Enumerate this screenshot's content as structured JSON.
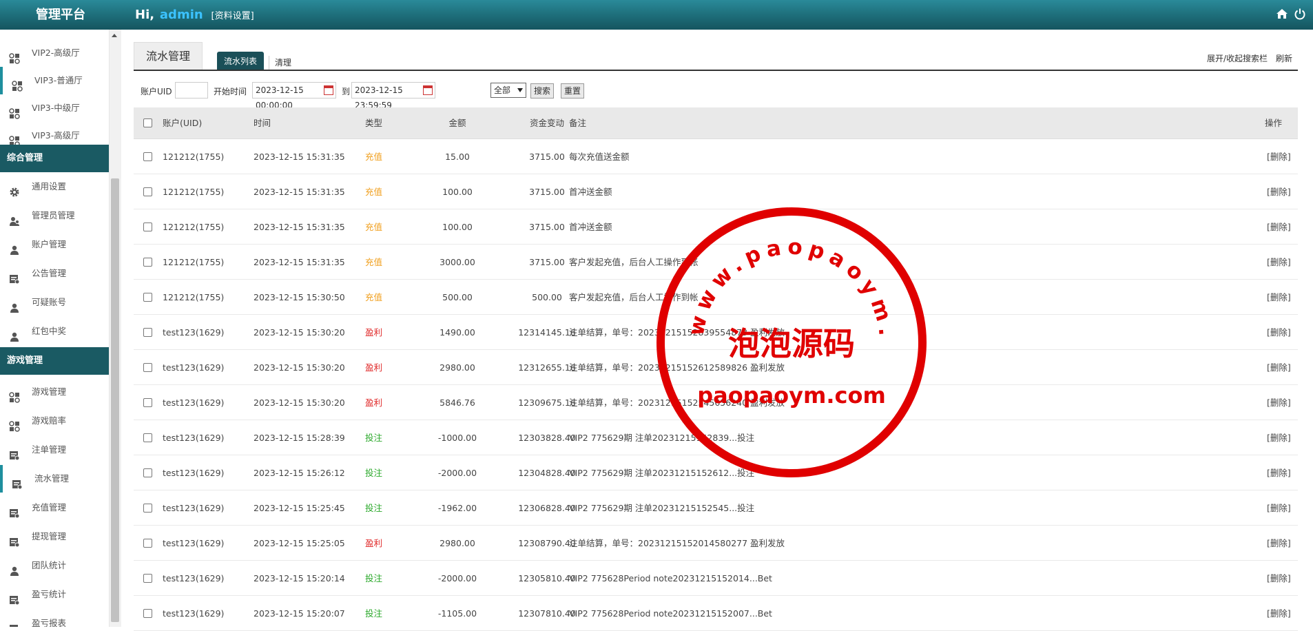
{
  "header": {
    "brand": "管理平台",
    "greeting": "Hi,",
    "user": "admin",
    "profile_link": "[资料设置]"
  },
  "sidebar": {
    "items_top": [
      {
        "label": "VIP2-高级厅",
        "icon": "grid-icon"
      },
      {
        "label": "VIP3-普通厅",
        "icon": "grid-icon"
      },
      {
        "label": "VIP3-中级厅",
        "icon": "grid-icon"
      },
      {
        "label": "VIP3-高级厅",
        "icon": "grid-icon"
      }
    ],
    "group1": "综合管理",
    "items_g1": [
      {
        "label": "通用设置",
        "icon": "gear-icon"
      },
      {
        "label": "管理员管理",
        "icon": "user-group-icon"
      },
      {
        "label": "账户管理",
        "icon": "user-icon"
      },
      {
        "label": "公告管理",
        "icon": "doc-icon"
      },
      {
        "label": "可疑账号",
        "icon": "user-icon"
      },
      {
        "label": "红包中奖",
        "icon": "user-icon"
      }
    ],
    "group2": "游戏管理",
    "items_g2": [
      {
        "label": "游戏管理",
        "icon": "grid-icon"
      },
      {
        "label": "游戏赔率",
        "icon": "grid-icon"
      },
      {
        "label": "注单管理",
        "icon": "doc-icon"
      },
      {
        "label": "流水管理",
        "icon": "doc-icon"
      },
      {
        "label": "充值管理",
        "icon": "doc-icon"
      },
      {
        "label": "提现管理",
        "icon": "doc-icon"
      },
      {
        "label": "团队统计",
        "icon": "user-icon"
      },
      {
        "label": "盈亏统计",
        "icon": "doc-icon"
      },
      {
        "label": "盈亏报表",
        "icon": "doc-icon"
      }
    ]
  },
  "tabs": {
    "main": "流水管理",
    "list": "流水列表",
    "clear": "清理",
    "toggle": "展开/收起搜索栏",
    "refresh": "刷新"
  },
  "filter": {
    "uid_label": "账户UID",
    "uid_value": "",
    "start_label": "开始时间",
    "start_value": "2023-12-15 00:00:00",
    "to_label": "到",
    "end_value": "2023-12-15 23:59:59",
    "type_value": "全部",
    "search": "搜索",
    "reset": "重置"
  },
  "columns": [
    "账户(UID)",
    "时间",
    "类型",
    "金额",
    "资金变动",
    "备注",
    "操作"
  ],
  "rows": [
    {
      "account": "121212(1755)",
      "time": "2023-12-15 15:31:35",
      "type": "充值",
      "color": "#f0a020",
      "amount": "15.00",
      "change": "3715.00",
      "note": "每次充值送金额",
      "op": "[删除]"
    },
    {
      "account": "121212(1755)",
      "time": "2023-12-15 15:31:35",
      "type": "充值",
      "color": "#f0a020",
      "amount": "100.00",
      "change": "3715.00",
      "note": "首冲送金额",
      "op": "[删除]"
    },
    {
      "account": "121212(1755)",
      "time": "2023-12-15 15:31:35",
      "type": "充值",
      "color": "#f0a020",
      "amount": "100.00",
      "change": "3715.00",
      "note": "首冲送金额",
      "op": "[删除]"
    },
    {
      "account": "121212(1755)",
      "time": "2023-12-15 15:31:35",
      "type": "充值",
      "color": "#f0a020",
      "amount": "3000.00",
      "change": "3715.00",
      "note": "客户发起充值，后台人工操作到帐",
      "op": "[删除]"
    },
    {
      "account": "121212(1755)",
      "time": "2023-12-15 15:30:50",
      "type": "充值",
      "color": "#f0a020",
      "amount": "500.00",
      "change": "500.00",
      "note": "客户发起充值，后台人工操作到帐",
      "op": "[删除]"
    },
    {
      "account": "test123(1629)",
      "time": "2023-12-15 15:30:20",
      "type": "盈利",
      "color": "#e02a2a",
      "amount": "1490.00",
      "change": "12314145.16",
      "note": "注单结算，单号：20231215152839554873 盈利发放",
      "op": "[删除]"
    },
    {
      "account": "test123(1629)",
      "time": "2023-12-15 15:30:20",
      "type": "盈利",
      "color": "#e02a2a",
      "amount": "2980.00",
      "change": "12312655.16",
      "note": "注单结算，单号：20231215152612589826 盈利发放",
      "op": "[删除]"
    },
    {
      "account": "test123(1629)",
      "time": "2023-12-15 15:30:20",
      "type": "盈利",
      "color": "#e02a2a",
      "amount": "5846.76",
      "change": "12309675.16",
      "note": "注单结算，单号：20231215152545656240 盈利发放",
      "op": "[删除]"
    },
    {
      "account": "test123(1629)",
      "time": "2023-12-15 15:28:39",
      "type": "投注",
      "color": "#2aa82a",
      "amount": "-1000.00",
      "change": "12303828.40",
      "note": "VIP2 775629期 注单20231215152839...投注",
      "op": "[删除]"
    },
    {
      "account": "test123(1629)",
      "time": "2023-12-15 15:26:12",
      "type": "投注",
      "color": "#2aa82a",
      "amount": "-2000.00",
      "change": "12304828.40",
      "note": "VIP2 775629期 注单20231215152612...投注",
      "op": "[删除]"
    },
    {
      "account": "test123(1629)",
      "time": "2023-12-15 15:25:45",
      "type": "投注",
      "color": "#2aa82a",
      "amount": "-1962.00",
      "change": "12306828.40",
      "note": "VIP2 775629期 注单20231215152545...投注",
      "op": "[删除]"
    },
    {
      "account": "test123(1629)",
      "time": "2023-12-15 15:25:05",
      "type": "盈利",
      "color": "#e02a2a",
      "amount": "2980.00",
      "change": "12308790.40",
      "note": "注单结算，单号：20231215152014580277 盈利发放",
      "op": "[删除]"
    },
    {
      "account": "test123(1629)",
      "time": "2023-12-15 15:20:14",
      "type": "投注",
      "color": "#2aa82a",
      "amount": "-2000.00",
      "change": "12305810.40",
      "note": "VIP2 775628Period note20231215152014...Bet",
      "op": "[删除]"
    },
    {
      "account": "test123(1629)",
      "time": "2023-12-15 15:20:07",
      "type": "投注",
      "color": "#2aa82a",
      "amount": "-1105.00",
      "change": "12307810.40",
      "note": "VIP2 775628Period note20231215152007...Bet",
      "op": "[删除]"
    }
  ],
  "watermark": {
    "ring": "www.paopaoym.com",
    "cn": "泡泡源码",
    "en": "paopaoym.com"
  }
}
